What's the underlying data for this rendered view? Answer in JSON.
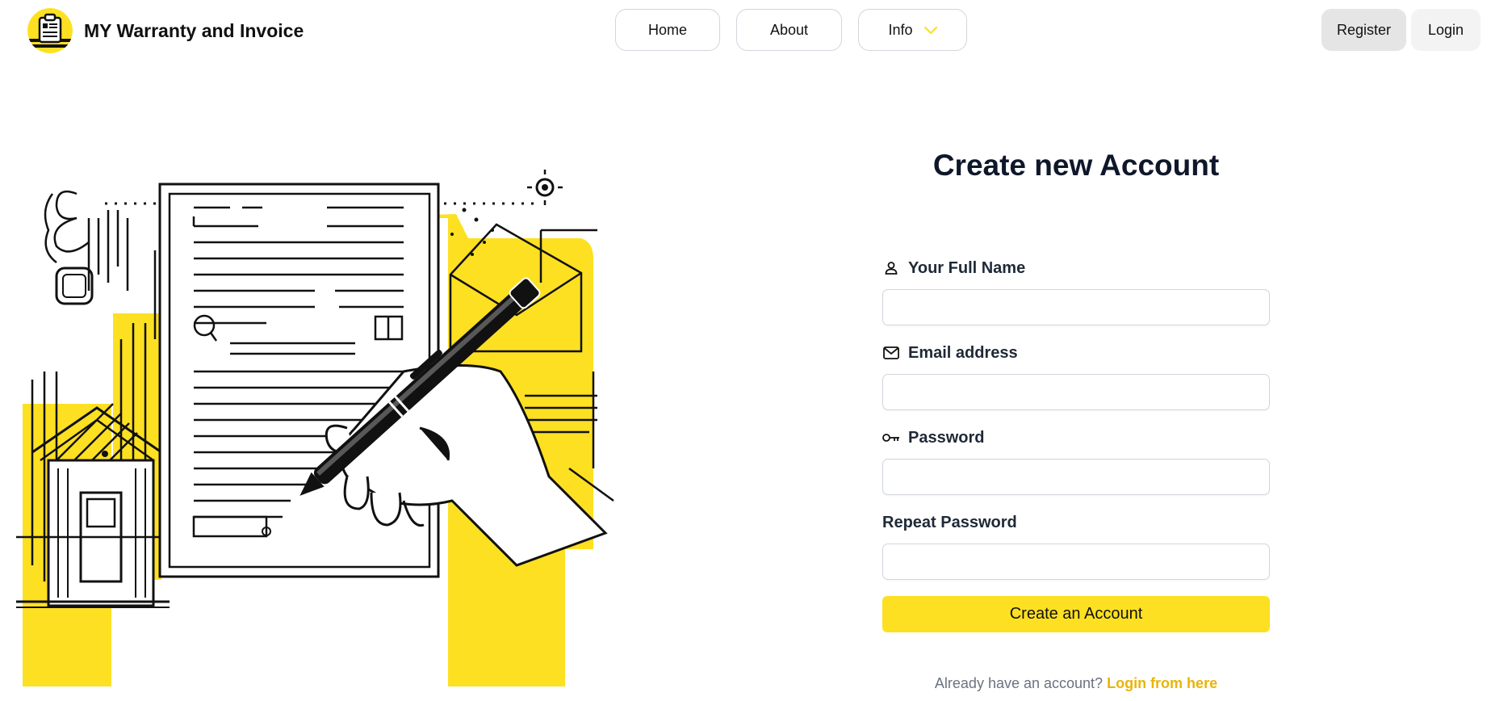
{
  "brand": {
    "name": "MY Warranty and Invoice",
    "logo_icon": "warranty-invoice-logo-icon",
    "accent": "#fde022"
  },
  "nav": {
    "home": "Home",
    "about": "About",
    "info": "Info",
    "info_icon": "chevron-down-icon"
  },
  "auth": {
    "register": "Register",
    "login": "Login"
  },
  "form": {
    "title": "Create new Account",
    "full_name": {
      "label": "Your Full Name",
      "icon": "user-icon",
      "value": ""
    },
    "email": {
      "label": "Email address",
      "icon": "envelope-icon",
      "value": ""
    },
    "password": {
      "label": "Password",
      "icon": "key-icon",
      "value": ""
    },
    "repeat_password": {
      "label": "Repeat Password",
      "value": ""
    },
    "submit": "Create an Account",
    "login_prompt": "Already have an account?",
    "login_link": "Login from here"
  },
  "illustration": {
    "subject": "hand-signing-document-illustration"
  }
}
